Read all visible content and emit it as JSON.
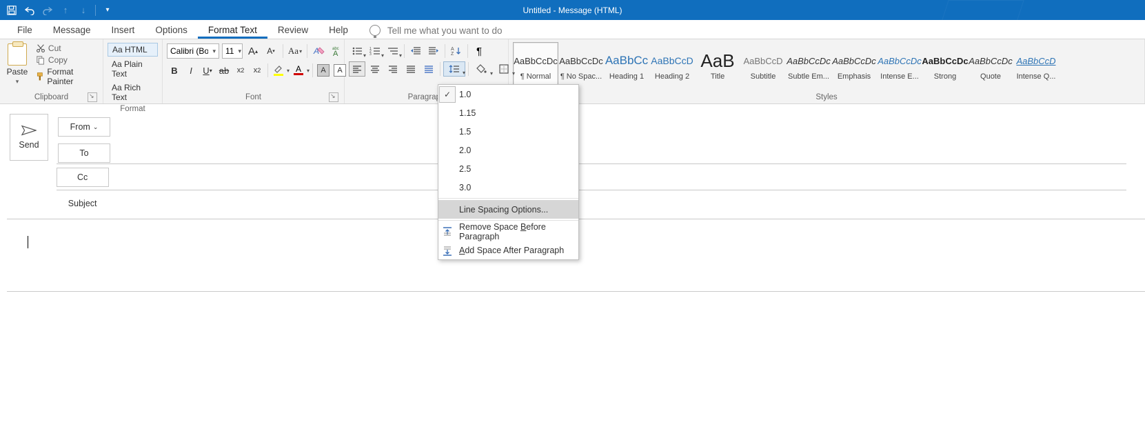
{
  "titlebar": {
    "title": "Untitled  -  Message (HTML)"
  },
  "qat": {
    "save": "💾",
    "undo": "↶",
    "redo": "↷",
    "up": "↑",
    "down": "↓",
    "customize": "▾"
  },
  "tabs": {
    "file": "File",
    "message": "Message",
    "insert": "Insert",
    "options": "Options",
    "format_text": "Format Text",
    "review": "Review",
    "help": "Help",
    "tell_me": "Tell me what you want to do"
  },
  "ribbon": {
    "clipboard": {
      "label": "Clipboard",
      "paste": "Paste",
      "cut": "Cut",
      "copy": "Copy",
      "format_painter": "Format Painter"
    },
    "format": {
      "label": "Format",
      "html": "Aa HTML",
      "plain": "Aa Plain Text",
      "rich": "Aa Rich Text"
    },
    "font": {
      "label": "Font",
      "name": "Calibri (Body)",
      "size": "11",
      "case": "Aa"
    },
    "paragraph": {
      "label": "Paragraph"
    },
    "styles": {
      "label": "Styles",
      "items": [
        {
          "preview": "AaBbCcDc",
          "name": "¶ Normal",
          "color": "#333333",
          "size": "13px",
          "italic": false,
          "underline": false
        },
        {
          "preview": "AaBbCcDc",
          "name": "¶ No Spac...",
          "color": "#333333",
          "size": "13px",
          "italic": false,
          "underline": false
        },
        {
          "preview": "AaBbCc",
          "name": "Heading 1",
          "color": "#2e74b5",
          "size": "17px",
          "italic": false,
          "underline": false
        },
        {
          "preview": "AaBbCcD",
          "name": "Heading 2",
          "color": "#2e74b5",
          "size": "14px",
          "italic": false,
          "underline": false
        },
        {
          "preview": "AaB",
          "name": "Title",
          "color": "#222222",
          "size": "26px",
          "italic": false,
          "underline": false
        },
        {
          "preview": "AaBbCcD",
          "name": "Subtitle",
          "color": "#767676",
          "size": "13px",
          "italic": false,
          "underline": false
        },
        {
          "preview": "AaBbCcDc",
          "name": "Subtle Em...",
          "color": "#333333",
          "size": "13px",
          "italic": true,
          "underline": false
        },
        {
          "preview": "AaBbCcDc",
          "name": "Emphasis",
          "color": "#333333",
          "size": "13px",
          "italic": true,
          "underline": false
        },
        {
          "preview": "AaBbCcDc",
          "name": "Intense E...",
          "color": "#2e74b5",
          "size": "13px",
          "italic": true,
          "underline": false
        },
        {
          "preview": "AaBbCcDc",
          "name": "Strong",
          "color": "#222222",
          "size": "13px",
          "italic": false,
          "underline": false,
          "bold": true
        },
        {
          "preview": "AaBbCcDc",
          "name": "Quote",
          "color": "#333333",
          "size": "13px",
          "italic": true,
          "underline": false
        },
        {
          "preview": "AaBbCcD",
          "name": "Intense Q...",
          "color": "#2e74b5",
          "size": "13px",
          "italic": true,
          "underline": true
        }
      ]
    }
  },
  "dropdown": {
    "vals": [
      "1.0",
      "1.15",
      "1.5",
      "2.0",
      "2.5",
      "3.0"
    ],
    "checked_index": 0,
    "opts": "Line Spacing Options...",
    "remove_before": "Remove Space Before Paragraph",
    "add_after": "Add Space After Paragraph",
    "underline_chars": {
      "remove_before": "B",
      "add_after": "A"
    }
  },
  "compose": {
    "send": "Send",
    "from": "From",
    "to": "To",
    "cc": "Cc",
    "subject": "Subject"
  }
}
